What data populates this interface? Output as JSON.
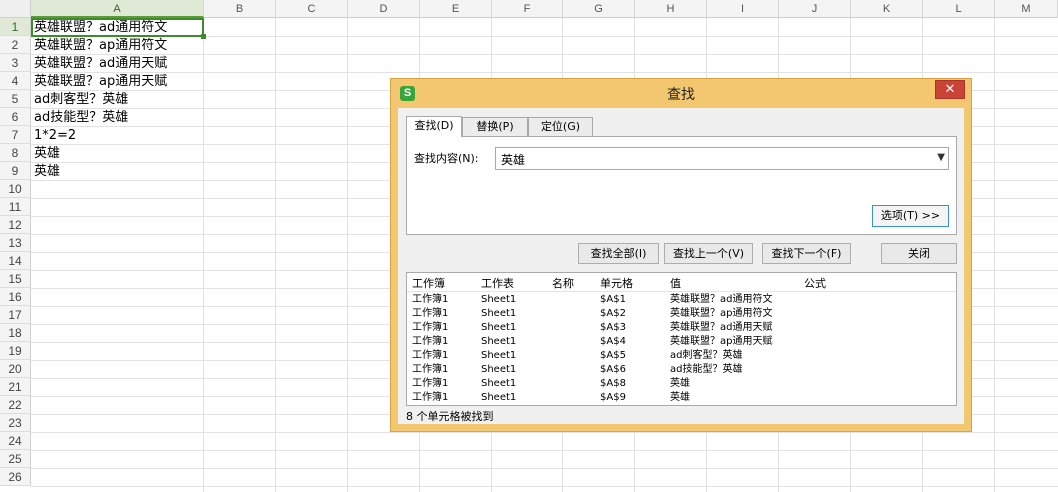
{
  "columns": [
    "A",
    "B",
    "C",
    "D",
    "E",
    "F",
    "G",
    "H",
    "I",
    "J",
    "K",
    "L",
    "M"
  ],
  "rows": [
    "1",
    "2",
    "3",
    "4",
    "5",
    "6",
    "7",
    "8",
    "9",
    "10",
    "11",
    "12",
    "13",
    "14",
    "15",
    "16",
    "17",
    "18",
    "19",
    "20",
    "21",
    "22",
    "23",
    "24",
    "25",
    "26"
  ],
  "cells": [
    "英雄联盟？ad通用符文",
    "英雄联盟？ap通用符文",
    "英雄联盟？ad通用天赋",
    "英雄联盟？ap通用天赋",
    "ad刺客型？英雄",
    "ad技能型？英雄",
    "1*2=2",
    "英雄",
    "英雄"
  ],
  "selected_cell": "A1",
  "dialog": {
    "title": "查找",
    "close_icon": "✕",
    "app_icon_letter": "S",
    "tabs": [
      {
        "label": "查找(D)"
      },
      {
        "label": "替换(P)"
      },
      {
        "label": "定位(G)"
      }
    ],
    "active_tab": "查找(D)",
    "find_label": "查找内容(N):",
    "find_value": "英雄",
    "options_label": "选项(T) >>",
    "buttons": {
      "find_all": "查找全部(I)",
      "find_prev": "查找上一个(V)",
      "find_next": "查找下一个(F)",
      "close": "关闭"
    },
    "results": {
      "headers": [
        "工作簿",
        "工作表",
        "名称",
        "单元格",
        "值",
        "公式"
      ],
      "rows": [
        [
          "工作簿1",
          "Sheet1",
          "",
          "$A$1",
          "英雄联盟？ad通用符文",
          ""
        ],
        [
          "工作簿1",
          "Sheet1",
          "",
          "$A$2",
          "英雄联盟？ap通用符文",
          ""
        ],
        [
          "工作簿1",
          "Sheet1",
          "",
          "$A$3",
          "英雄联盟？ad通用天赋",
          ""
        ],
        [
          "工作簿1",
          "Sheet1",
          "",
          "$A$4",
          "英雄联盟？ap通用天赋",
          ""
        ],
        [
          "工作簿1",
          "Sheet1",
          "",
          "$A$5",
          "ad刺客型？英雄",
          ""
        ],
        [
          "工作簿1",
          "Sheet1",
          "",
          "$A$6",
          "ad技能型？英雄",
          ""
        ],
        [
          "工作簿1",
          "Sheet1",
          "",
          "$A$8",
          "英雄",
          ""
        ],
        [
          "工作簿1",
          "Sheet1",
          "",
          "$A$9",
          "英雄",
          ""
        ]
      ]
    },
    "status": "8 个单元格被找到"
  },
  "colors": {
    "accent": "#3c8c2e",
    "dialog_frame": "#f2c76f",
    "close_button": "#c94436"
  }
}
